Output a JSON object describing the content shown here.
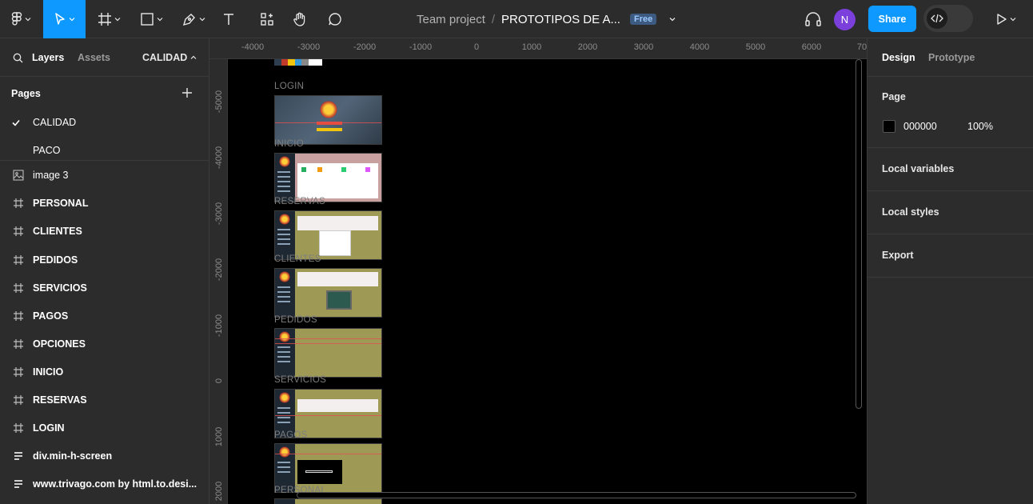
{
  "toolbar": {
    "team": "Team project",
    "separator": "/",
    "file_name": "PROTOTIPOS DE A...",
    "plan_badge": "Free",
    "avatar_initial": "N",
    "share_label": "Share",
    "accent": "#0d99ff"
  },
  "left_panel": {
    "tab_layers": "Layers",
    "tab_assets": "Assets",
    "current_page": "CALIDAD",
    "pages_header": "Pages",
    "pages": [
      "CALIDAD",
      "PACO"
    ],
    "layers": [
      {
        "name": "image 3",
        "icon": "image-icon"
      },
      {
        "name": "PERSONAL",
        "icon": "frame-icon"
      },
      {
        "name": "CLIENTES",
        "icon": "frame-icon"
      },
      {
        "name": "PEDIDOS",
        "icon": "frame-icon"
      },
      {
        "name": "SERVICIOS",
        "icon": "frame-icon"
      },
      {
        "name": "PAGOS",
        "icon": "frame-icon"
      },
      {
        "name": "OPCIONES",
        "icon": "frame-icon"
      },
      {
        "name": "INICIO",
        "icon": "frame-icon"
      },
      {
        "name": "RESERVAS",
        "icon": "frame-icon"
      },
      {
        "name": "LOGIN",
        "icon": "frame-icon"
      },
      {
        "name": "div.min-h-screen",
        "icon": "text-layer-icon"
      },
      {
        "name": "www.trivago.com by html.to.desi...",
        "icon": "text-layer-icon"
      }
    ]
  },
  "rulers": {
    "top": [
      "-4000",
      "-3000",
      "-2000",
      "-1000",
      "0",
      "1000",
      "2000",
      "3000",
      "4000",
      "5000",
      "6000",
      "70"
    ],
    "left": [
      "-5000",
      "-4000",
      "-3000",
      "-2000",
      "-1000",
      "0",
      "1000",
      "2000"
    ]
  },
  "canvas": {
    "frame_labels": [
      "LOGIN",
      "INICIO",
      "RESERVAS",
      "CLIENTES",
      "PEDIDOS",
      "SERVICIOS",
      "PAGOS",
      "PERSONAL"
    ]
  },
  "right_panel": {
    "tab_design": "Design",
    "tab_prototype": "Prototype",
    "page_section": "Page",
    "bg_hex": "000000",
    "bg_opacity": "100%",
    "local_variables": "Local variables",
    "local_styles": "Local styles",
    "export": "Export"
  }
}
